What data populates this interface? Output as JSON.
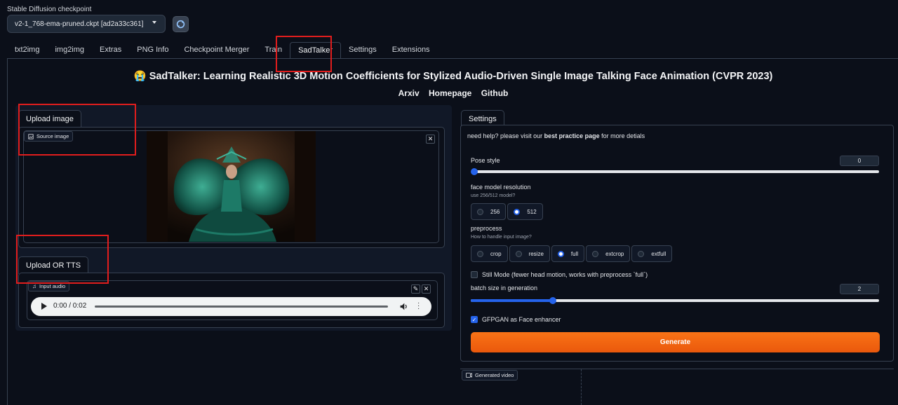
{
  "checkpoint": {
    "label": "Stable Diffusion checkpoint",
    "value": "v2-1_768-ema-pruned.ckpt [ad2a33c361]"
  },
  "tabs": [
    {
      "label": "txt2img"
    },
    {
      "label": "img2img"
    },
    {
      "label": "Extras"
    },
    {
      "label": "PNG Info"
    },
    {
      "label": "Checkpoint Merger"
    },
    {
      "label": "Train"
    },
    {
      "label": "SadTalker",
      "active": true
    },
    {
      "label": "Settings"
    },
    {
      "label": "Extensions"
    }
  ],
  "header": {
    "title": "😭 SadTalker: Learning Realistic 3D Motion Coefficients for Stylized Audio-Driven Single Image Talking Face Animation (CVPR 2023)",
    "links": [
      "Arxiv",
      "Homepage",
      "Github"
    ]
  },
  "left": {
    "upload_image_tab": "Upload image",
    "source_image_label": "Source image",
    "upload_tts_tab": "Upload OR TTS",
    "input_audio_label": "Input audio",
    "audio_time": "0:00 / 0:02"
  },
  "settings": {
    "tab_label": "Settings",
    "help_prefix": "need help? please visit our ",
    "help_link": "best practice page",
    "help_suffix": " for more detials",
    "pose_style_label": "Pose style",
    "pose_style_value": "0",
    "pose_style_fraction": 0,
    "face_res_label": "face model resolution",
    "face_res_hint": "use 256/512 model?",
    "face_res_options": [
      "256",
      "512"
    ],
    "face_res_selected": "512",
    "preprocess_label": "preprocess",
    "preprocess_hint": "How to handle input image?",
    "preprocess_options": [
      "crop",
      "resize",
      "full",
      "extcrop",
      "extfull"
    ],
    "preprocess_selected": "full",
    "still_mode_label": "Still Mode (fewer head motion, works with preprocess `full`)",
    "still_mode_checked": false,
    "batch_label": "batch size in generation",
    "batch_value": "2",
    "batch_fraction": 0.2,
    "gfpgan_label": "GFPGAN as Face enhancer",
    "gfpgan_checked": true,
    "generate_label": "Generate",
    "generated_video_label": "Generated video"
  },
  "colors": {
    "background": "#0b0f19",
    "accent": "#2563eb",
    "generate": "#f97316",
    "highlight": "#e11d1d"
  }
}
